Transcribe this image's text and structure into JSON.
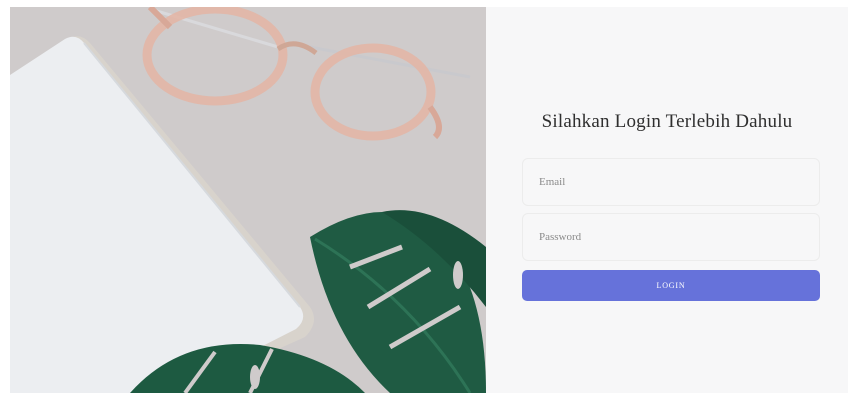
{
  "hero": {
    "image_description_icon": "glasses-notebook-monstera-photo",
    "colors": {
      "background": "#cfcbcb",
      "notebook": "#eef0f2",
      "leaf": "#1f5b43",
      "frame": "#e6b8a8"
    }
  },
  "login": {
    "title": "Silahkan Login Terlebih Dahulu",
    "email_placeholder": "Email",
    "email_value": "",
    "password_placeholder": "Password",
    "password_value": "",
    "button_label": "LOGIN",
    "accent_color": "#6672da"
  }
}
